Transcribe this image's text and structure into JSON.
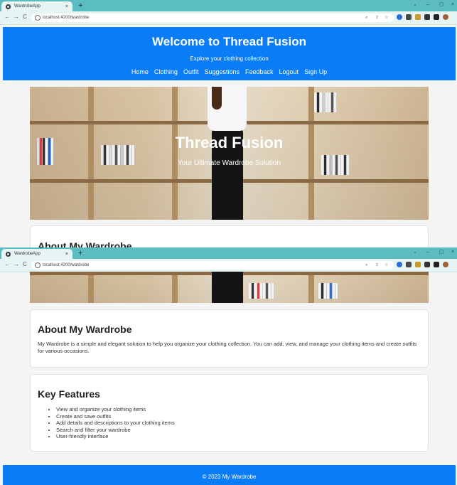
{
  "browser": {
    "tab_title": "WardrobeApp",
    "tab_close": "×",
    "new_tab": "+",
    "window_controls": [
      "⌄",
      "–",
      "▢",
      "×"
    ],
    "nav_buttons": [
      "←",
      "→",
      "C"
    ],
    "url": "localhost:4200/wardrobe",
    "icons": [
      "favicon-icon",
      "back-icon",
      "forward-icon",
      "reload-icon",
      "info-icon",
      "zoom-icon",
      "share-icon",
      "star-icon",
      "extension-icon",
      "profile-avatar"
    ]
  },
  "header": {
    "title": "Welcome to Thread Fusion",
    "subtitle": "Explore your clothing collection",
    "nav": [
      "Home",
      "Clothing",
      "Outfit",
      "Suggestions",
      "Feedback",
      "Logout",
      "Sign Up"
    ]
  },
  "hero": {
    "title": "Thread Fusion",
    "subtitle": "Your Ultimate Wardrobe Solution"
  },
  "about": {
    "title": "About My Wardrobe",
    "text": "My Wardrobe is a simple and elegant solution to help you organize your clothing collection. You can add, view, and manage your clothing items and create outfits for various occasions."
  },
  "features": {
    "title": "Key Features",
    "items": [
      "View and organize your clothing items",
      "Create and save outfits",
      "Add details and descriptions to your clothing items",
      "Search and filter your wardrobe",
      "User-friendly interface"
    ]
  },
  "footer": {
    "text": "© 2023 My Wardrobe"
  },
  "colors": {
    "header_bg": "#0a7cf5",
    "browser_frame": "#5bbdbf",
    "page_bg": "#f4f4f4"
  }
}
